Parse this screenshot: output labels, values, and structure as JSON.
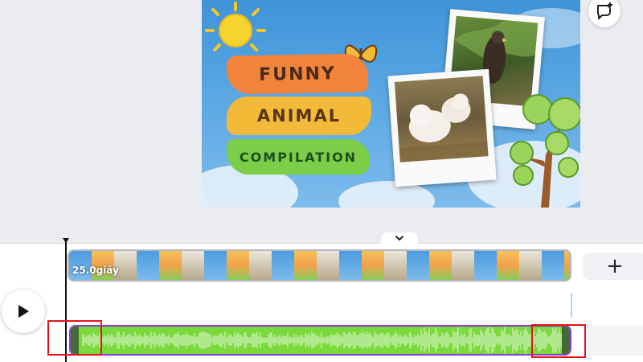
{
  "design": {
    "title_line_1": "FUNNY",
    "title_line_2": "ANIMAL",
    "title_line_3": "COMPILATION",
    "colors": {
      "sky": "#3e93d8",
      "brush_orange": "#f2833a",
      "brush_yellow": "#f3b938",
      "brush_green": "#7ccd47"
    }
  },
  "toolbar": {
    "comment_icon": "comment-add-icon"
  },
  "timeline": {
    "video_clip": {
      "duration_label": "25.0giây"
    },
    "add_button_label": "+",
    "play_icon": "play-icon",
    "collapse_icon": "chevron-down-icon",
    "audio_clip": {
      "color": "#7ad93b",
      "border": "#8a3fd3"
    }
  }
}
